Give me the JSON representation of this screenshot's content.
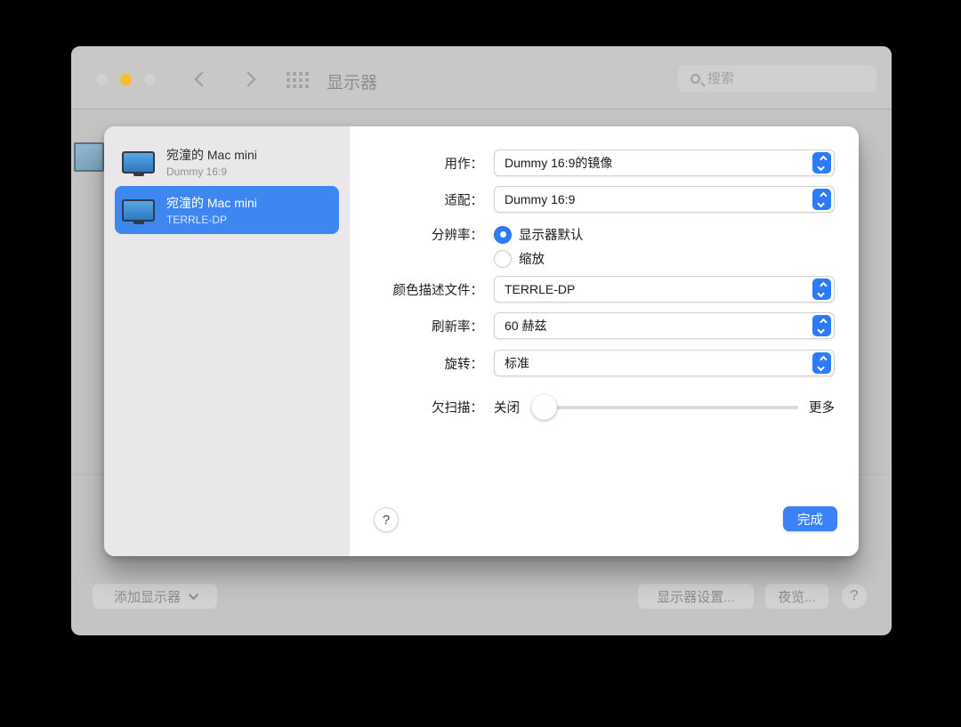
{
  "window": {
    "title": "显示器",
    "search_placeholder": "搜索"
  },
  "sidebar": {
    "items": [
      {
        "title": "宛潼的 Mac mini",
        "subtitle": "Dummy 16:9",
        "selected": false
      },
      {
        "title": "宛潼的 Mac mini",
        "subtitle": "TERRLE-DP",
        "selected": true
      }
    ]
  },
  "form": {
    "use_as": {
      "label": "用作：",
      "value": "Dummy 16:9的镜像"
    },
    "optimize_for": {
      "label": "适配：",
      "value": "Dummy 16:9"
    },
    "resolution": {
      "label": "分辨率：",
      "options": [
        {
          "label": "显示器默认",
          "selected": true
        },
        {
          "label": "缩放",
          "selected": false
        }
      ]
    },
    "color_profile": {
      "label": "颜色描述文件：",
      "value": "TERRLE-DP"
    },
    "refresh_rate": {
      "label": "刷新率：",
      "value": "60 赫兹"
    },
    "rotation": {
      "label": "旋转：",
      "value": "标准"
    },
    "underscan": {
      "label": "欠扫描：",
      "min_label": "关闭",
      "max_label": "更多",
      "value_percent": 0
    }
  },
  "sheet_footer": {
    "help_label": "?",
    "done_label": "完成"
  },
  "bottom_bar": {
    "add_display_label": "添加显示器",
    "display_settings_label": "显示器设置...",
    "night_shift_label": "夜览...",
    "help_label": "?"
  },
  "colors": {
    "accent_blue": "#2d7cf7",
    "selection_blue": "#3e87f0",
    "done_blue": "#3b82f6",
    "traffic_yellow": "#f7bb2f",
    "sheet_sidebar": "#e9e7ea",
    "window_chrome": "#cac7c7"
  }
}
